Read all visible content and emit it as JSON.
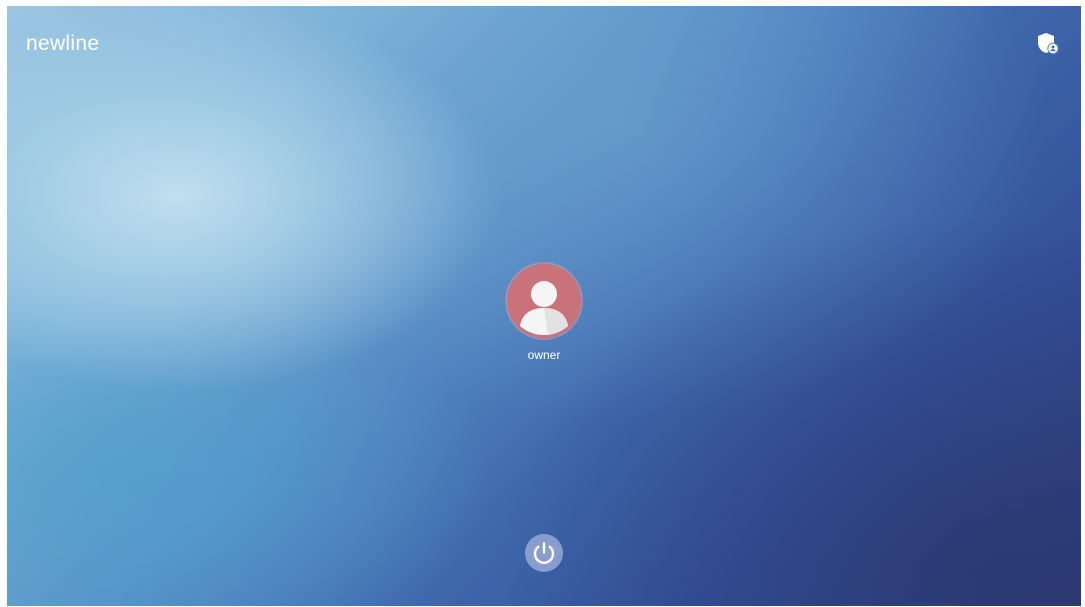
{
  "brand": {
    "logo_text": "newline"
  },
  "header": {
    "admin_icon": "shield-user-icon"
  },
  "users": [
    {
      "name": "owner",
      "avatar_icon": "user-avatar-icon",
      "avatar_color": "#c9727a"
    }
  ],
  "footer": {
    "power_icon": "power-icon"
  },
  "colors": {
    "background_light": "#c4e1f0",
    "background_dark": "#2f3f7c",
    "text": "#ffffff"
  }
}
